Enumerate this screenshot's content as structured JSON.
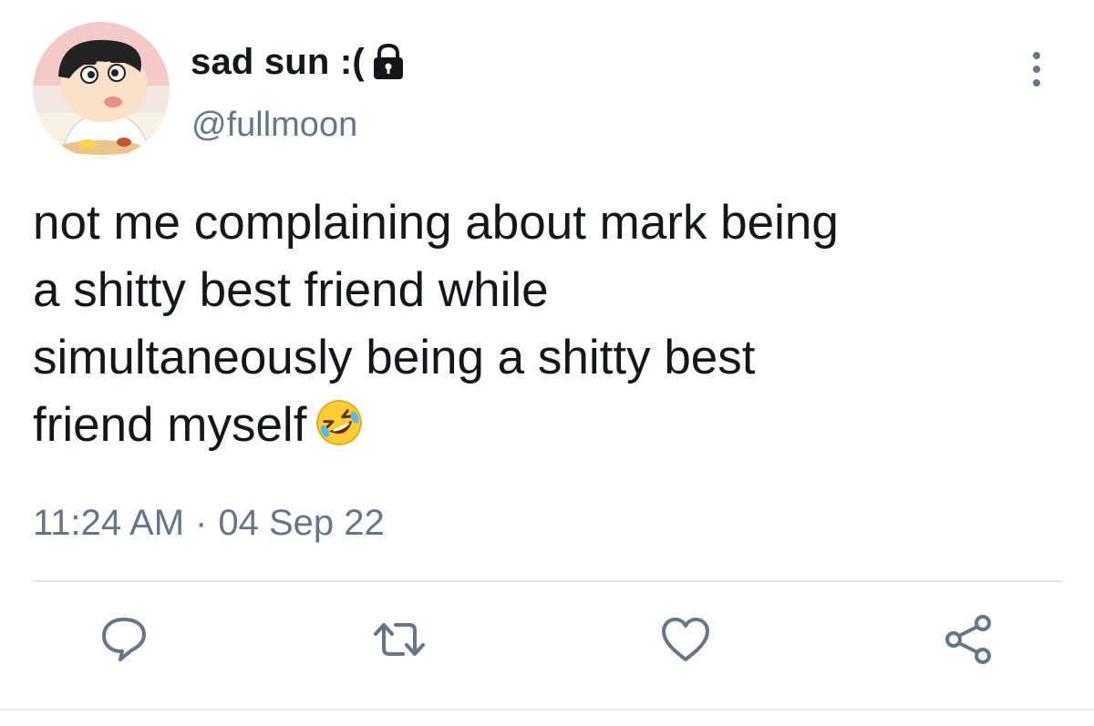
{
  "user": {
    "display_name": "sad sun :(",
    "handle": "@fullmoon",
    "protected": true,
    "avatar_icon": "avatar-cartoon-icon"
  },
  "tweet": {
    "text": "not me complaining about mark being\na shitty best friend while\nsimultaneously being a shitty best\nfriend myself",
    "emoji": "rolling-on-the-floor-laughing"
  },
  "meta": {
    "time": "11:24 AM",
    "separator": "·",
    "date": "04 Sep 22"
  },
  "actions": [
    {
      "name": "reply",
      "icon": "reply-icon"
    },
    {
      "name": "retweet",
      "icon": "retweet-icon"
    },
    {
      "name": "like",
      "icon": "heart-icon"
    },
    {
      "name": "share",
      "icon": "share-icon"
    }
  ],
  "colors": {
    "text_primary": "#14171a",
    "text_secondary": "#657786",
    "divider": "#e1e8ed"
  }
}
